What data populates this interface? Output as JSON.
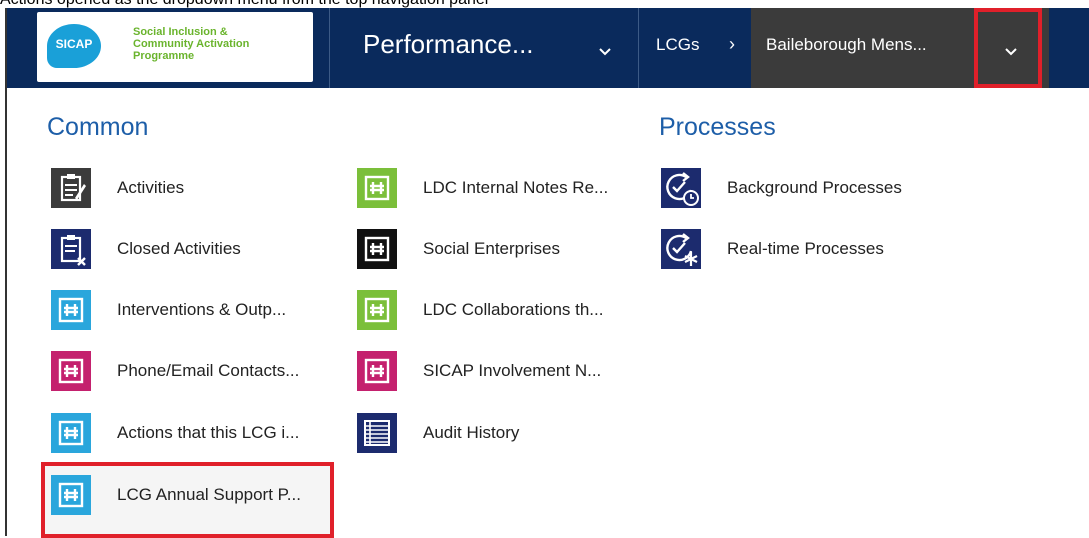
{
  "caption": "Actions opened as the dropdown menu from the top navigation panel",
  "nav": {
    "logo_badge": "SICAP",
    "logo_lines": [
      "Social Inclusion &",
      "Community Activation",
      "Programme"
    ],
    "area_title": "Performance...",
    "breadcrumb_entity": "LCGs",
    "breadcrumb_sep": "›",
    "record_title": "Baileborough Mens..."
  },
  "sections": {
    "common_title": "Common",
    "processes_title": "Processes"
  },
  "common_col1": [
    {
      "label": "Activities",
      "icon": "activities-icon",
      "color": "#3b3b3b"
    },
    {
      "label": "Closed Activities",
      "icon": "closed-activities-icon",
      "color": "#1c2b6e"
    },
    {
      "label": "Interventions & Outp...",
      "icon": "entity-icon",
      "color": "#2aa6dc"
    },
    {
      "label": "Phone/Email Contacts...",
      "icon": "entity-icon",
      "color": "#c4216e"
    },
    {
      "label": "Actions that this LCG i...",
      "icon": "entity-icon",
      "color": "#2aa6dc"
    },
    {
      "label": "LCG Annual Support P...",
      "icon": "entity-icon",
      "color": "#2aa6dc"
    }
  ],
  "common_col2": [
    {
      "label": "LDC Internal Notes Re...",
      "icon": "entity-icon",
      "color": "#7bbf3a"
    },
    {
      "label": "Social Enterprises",
      "icon": "entity-icon",
      "color": "#111111"
    },
    {
      "label": "LDC Collaborations th...",
      "icon": "entity-icon",
      "color": "#7bbf3a"
    },
    {
      "label": "SICAP Involvement N...",
      "icon": "entity-icon",
      "color": "#c4216e"
    },
    {
      "label": "Audit History",
      "icon": "audit-history-icon",
      "color": "#1c2b6e"
    }
  ],
  "processes": [
    {
      "label": "Background Processes",
      "icon": "background-process-icon",
      "color": "#1c2b6e"
    },
    {
      "label": "Real-time Processes",
      "icon": "realtime-process-icon",
      "color": "#1c2b6e"
    }
  ],
  "colors": {
    "navbar": "#0a2a5c",
    "record_bg": "#3b3b3b",
    "highlight": "#e0202a",
    "section_title": "#1d5ea8"
  }
}
